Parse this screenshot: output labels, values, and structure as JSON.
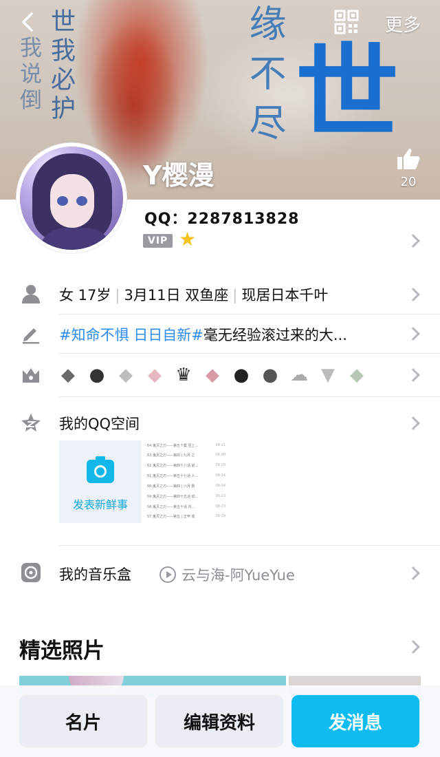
{
  "cover": {
    "calligraphy_left": "世我必护",
    "calligraphy_left2": "我说倒",
    "calligraphy_right": "缘不尽",
    "calligraphy_big": "世"
  },
  "header": {
    "more_label": "更多"
  },
  "profile": {
    "nickname": "Y樱漫",
    "likes": "20",
    "qq_label": "QQ：2287813828",
    "vip_label": "VIP"
  },
  "rows": {
    "basic": {
      "gender_age": "女 17岁",
      "birthday": "3月11日 双鱼座",
      "location": "现居日本千叶"
    },
    "signature": {
      "tag": "#知命不惧 日日自新#",
      "text": "毫无经验滚过来的大..."
    },
    "qzone": {
      "label": "我的QQ空间",
      "post_button": "发表新鲜事",
      "list": [
        {
          "title": "64.鬼灭之刃——第五十集 至上...",
          "date": "09-21"
        },
        {
          "title": "63.鬼灭之刃——第四 | 九月 之",
          "date": "09-20"
        },
        {
          "title": "62.鬼灭之刃——第四十八话 前...",
          "date": "09-20"
        },
        {
          "title": "61.鬼灭之刃——第五十七话 人...",
          "date": "09-24"
        },
        {
          "title": "60.鬼灭之刃——第四 | 六月 剧",
          "date": "09-24"
        },
        {
          "title": "59.鬼灭之刃——第四十五话 动...",
          "date": "09-23"
        },
        {
          "title": "58.鬼灭之刃——第五十话 内...",
          "date": "09-23"
        },
        {
          "title": "57.鬼灭之刃——第五 | 正甲 成",
          "date": "09-19"
        }
      ]
    },
    "music": {
      "label": "我的音乐盒",
      "song": "云与海-阿YueYue"
    }
  },
  "photos": {
    "title": "精选照片"
  },
  "bottom_bar": {
    "card": "名片",
    "edit": "编辑资料",
    "message": "发消息"
  },
  "colors": {
    "accent": "#0fbcf2",
    "tag_blue": "#2e8bef",
    "icon_gray": "#8e8e93"
  },
  "icons": {
    "back": "chevron-left-icon",
    "qr": "qr-code-icon",
    "like": "thumbs-up-icon",
    "person": "person-icon",
    "pen": "pen-icon",
    "crown": "crown-icon",
    "qzone": "qzone-star-icon",
    "music": "music-disc-icon",
    "badges": [
      "diamond-penguin-icon",
      "penguin-icon",
      "diamond-icon",
      "pink-diamond-icon",
      "crown-penguin-icon",
      "pink-diamond-icon",
      "penguin-bag-icon",
      "penguin-plus-icon",
      "vcloud-icon",
      "v-wing-icon",
      "green-diamond-icon"
    ]
  }
}
